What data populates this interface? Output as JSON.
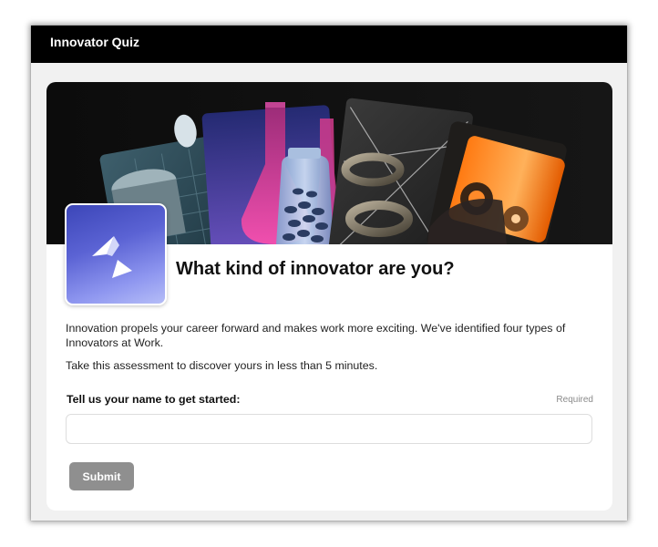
{
  "app": {
    "title": "Innovator Quiz"
  },
  "hero": {
    "alt": "Collage of glass laboratory flasks, metallic rings and orange metal rolls",
    "logo_icon": "two-arrow-chevron-logo-icon"
  },
  "quiz": {
    "heading": "What kind of innovator are you?",
    "intro": "Innovation propels your career forward and makes work more exciting. We've identified four types of Innovators at Work.",
    "intro2": "Take this assessment to discover yours in less than 5 minutes.",
    "name_label": "Tell us your name to get started:",
    "required": "Required",
    "name_value": "",
    "name_placeholder": "",
    "submit_label": "Submit"
  },
  "colors": {
    "titlebar": "#000000",
    "submit_disabled": "#8f8f8f",
    "logo_gradient_start": "#3c46b8",
    "logo_gradient_end": "#b5bdf7"
  }
}
